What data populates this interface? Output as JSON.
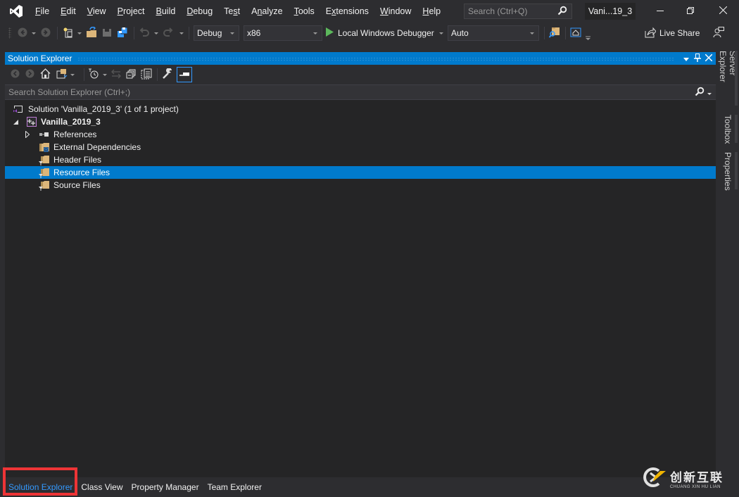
{
  "app": {
    "logo": "visual-studio-logo",
    "title_badge": "Vani...19_3",
    "search_placeholder": "Search (Ctrl+Q)"
  },
  "menu": [
    {
      "label": "File",
      "accel": "F",
      "rest": "ile"
    },
    {
      "label": "Edit",
      "accel": "E",
      "rest": "dit"
    },
    {
      "label": "View",
      "accel": "V",
      "rest": "iew"
    },
    {
      "label": "Project",
      "accel": "P",
      "rest": "roject"
    },
    {
      "label": "Build",
      "accel": "B",
      "rest": "uild"
    },
    {
      "label": "Debug",
      "accel": "D",
      "rest": "ebug"
    },
    {
      "label": "Test",
      "pre": "Te",
      "accel": "s",
      "rest": "t"
    },
    {
      "label": "Analyze",
      "pre": "A",
      "accel": "n",
      "rest": "alyze"
    },
    {
      "label": "Tools",
      "accel": "T",
      "rest": "ools"
    },
    {
      "label": "Extensions",
      "pre": "E",
      "accel": "x",
      "rest": "tensions"
    },
    {
      "label": "Window",
      "accel": "W",
      "rest": "indow"
    },
    {
      "label": "Help",
      "accel": "H",
      "rest": "elp"
    }
  ],
  "window_controls": {
    "minimize": "minimize-icon",
    "restore": "restore-icon",
    "close": "close-icon"
  },
  "toolbar": {
    "configuration": "Debug",
    "platform": "x86",
    "run_label": "Local Windows Debugger",
    "debug_target": "Auto",
    "live_share": "Live Share",
    "icons": [
      "back-icon",
      "forward-icon",
      "new-project-icon",
      "open-folder-icon",
      "save-icon",
      "save-all-icon",
      "undo-icon",
      "redo-icon",
      "play-icon",
      "find-in-files-icon",
      "browser-home-icon",
      "live-share-icon",
      "feedback-icon"
    ]
  },
  "solution_explorer": {
    "title": "Solution Explorer",
    "search_placeholder": "Search Solution Explorer (Ctrl+;)",
    "toolbar_icons": [
      "back-icon",
      "forward-icon",
      "home-icon",
      "switch-views-icon",
      "pending-changes-filter-icon",
      "sync-icon",
      "collapse-all-icon",
      "show-all-files-icon",
      "properties-icon",
      "preview-icon"
    ],
    "tree": [
      {
        "label": "Solution 'Vanilla_2019_3' (1 of 1 project)",
        "level": 0,
        "icon": "solution-icon",
        "expander": "none",
        "bold": false,
        "selected": false
      },
      {
        "label": "Vanilla_2019_3",
        "level": 1,
        "icon": "cpp-project-icon",
        "expander": "expanded",
        "bold": true,
        "selected": false
      },
      {
        "label": "References",
        "level": 2,
        "icon": "references-icon",
        "expander": "collapsed",
        "bold": false,
        "selected": false
      },
      {
        "label": "External Dependencies",
        "level": 2,
        "icon": "external-dependencies-icon",
        "expander": "none",
        "bold": false,
        "selected": false
      },
      {
        "label": "Header Files",
        "level": 2,
        "icon": "filter-folder-icon",
        "expander": "none",
        "bold": false,
        "selected": false
      },
      {
        "label": "Resource Files",
        "level": 2,
        "icon": "filter-folder-icon",
        "expander": "none",
        "bold": false,
        "selected": true
      },
      {
        "label": "Source Files",
        "level": 2,
        "icon": "filter-folder-icon",
        "expander": "none",
        "bold": false,
        "selected": false
      }
    ]
  },
  "right_rail": {
    "tabs": [
      "Server Explorer",
      "Toolbox",
      "Properties"
    ]
  },
  "bottom_tabs": [
    {
      "label": "Solution Explorer",
      "active": true
    },
    {
      "label": "Class View",
      "active": false
    },
    {
      "label": "Property Manager",
      "active": false
    },
    {
      "label": "Team Explorer",
      "active": false
    }
  ],
  "watermark": {
    "chinese": "创新互联",
    "pinyin": "CHUANG XIN HU LIAN"
  },
  "colors": {
    "accent": "#007acc",
    "active_tab_text": "#3399ff",
    "highlight_box": "#ee3436"
  }
}
